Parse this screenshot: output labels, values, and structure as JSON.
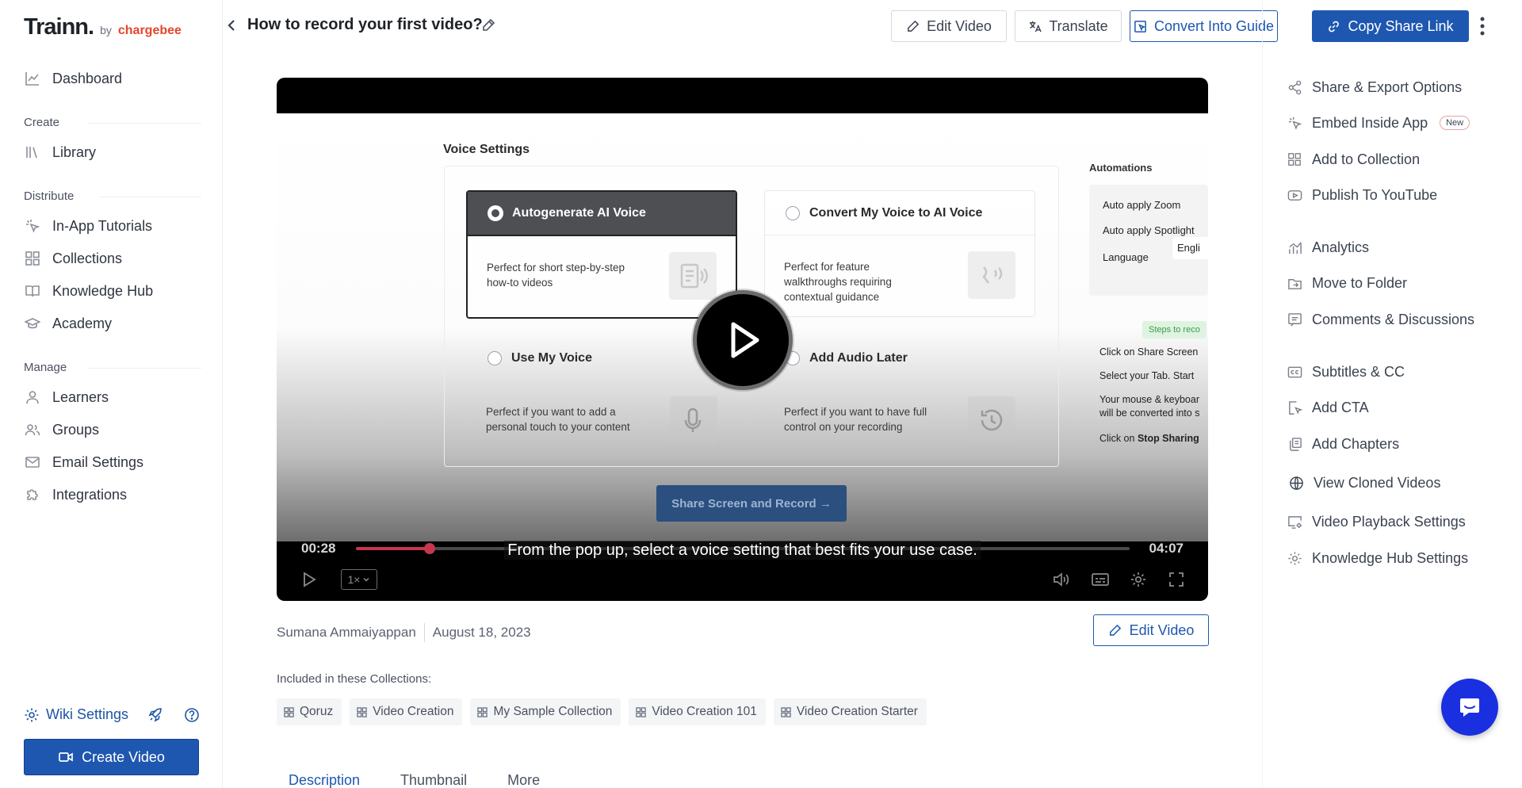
{
  "brand": {
    "name": "Trainn.",
    "by": "by",
    "company": "chargebee"
  },
  "sidebar": {
    "dashboard": "Dashboard",
    "sections": {
      "create": {
        "title": "Create",
        "items": [
          "Library"
        ]
      },
      "distribute": {
        "title": "Distribute",
        "items": [
          "In-App Tutorials",
          "Collections",
          "Knowledge Hub",
          "Academy"
        ]
      },
      "manage": {
        "title": "Manage",
        "items": [
          "Learners",
          "Groups",
          "Email Settings",
          "Integrations"
        ]
      }
    },
    "wiki_settings": "Wiki Settings",
    "create_video": "Create Video"
  },
  "header": {
    "title": "How to record your first video?",
    "edit_video": "Edit Video",
    "translate": "Translate",
    "convert_guide": "Convert Into Guide",
    "copy_share": "Copy Share Link"
  },
  "video": {
    "voice_settings_title": "Voice Settings",
    "options": [
      {
        "label": "Autogenerate AI Voice",
        "desc": "Perfect for short step-by-step how-to videos",
        "selected": true
      },
      {
        "label": "Convert My Voice to AI Voice",
        "desc": "Perfect for feature walkthroughs requiring contextual guidance",
        "selected": false
      },
      {
        "label": "Use My Voice",
        "desc": "Perfect if you want to add a personal touch to your content",
        "selected": false
      },
      {
        "label": "Add Audio Later",
        "desc": "Perfect if you want to have full control on your recording",
        "selected": false
      }
    ],
    "share_record": "Share Screen and Record →",
    "automations": {
      "title": "Automations",
      "zoom": "Auto apply Zoom",
      "spotlight": "Auto apply Spotlight",
      "language": "Language",
      "language_value": "Engli"
    },
    "steps": {
      "badge": "Steps to reco",
      "s1": "Click on Share Screen",
      "s2": "Select your Tab. Start",
      "s3a": "Your mouse & keyboar",
      "s3b": "will be converted into s",
      "s4_pre": "Click on ",
      "s4_bold": "Stop Sharing"
    },
    "current_time": "00:28",
    "total_time": "04:07",
    "progress": 0.095,
    "subtitle": "From the pop up, select a voice setting that best fits your use case.",
    "speed": "1×"
  },
  "meta": {
    "author": "Sumana Ammaiyappan",
    "date": "August 18, 2023",
    "edit_video": "Edit Video"
  },
  "collections": {
    "label": "Included in these Collections:",
    "items": [
      "Qoruz",
      "Video Creation",
      "My Sample Collection",
      "Video Creation 101",
      "Video Creation Starter"
    ]
  },
  "tabs": [
    "Description",
    "Thumbnail",
    "More"
  ],
  "right_panel": {
    "share_export": "Share & Export Options",
    "embed": "Embed Inside App",
    "embed_badge": "New",
    "add_collection": "Add to Collection",
    "publish_youtube": "Publish To YouTube",
    "analytics": "Analytics",
    "move_folder": "Move to Folder",
    "comments": "Comments & Discussions",
    "subtitles": "Subtitles & CC",
    "add_cta": "Add CTA",
    "add_chapters": "Add Chapters",
    "view_cloned": "View Cloned Videos",
    "playback_settings": "Video Playback Settings",
    "kh_settings": "Knowledge Hub Settings"
  },
  "colors": {
    "primary": "#1e57b0",
    "brand_red": "#e4472b",
    "progress": "#c6364f",
    "chat": "#1a2fe0"
  }
}
